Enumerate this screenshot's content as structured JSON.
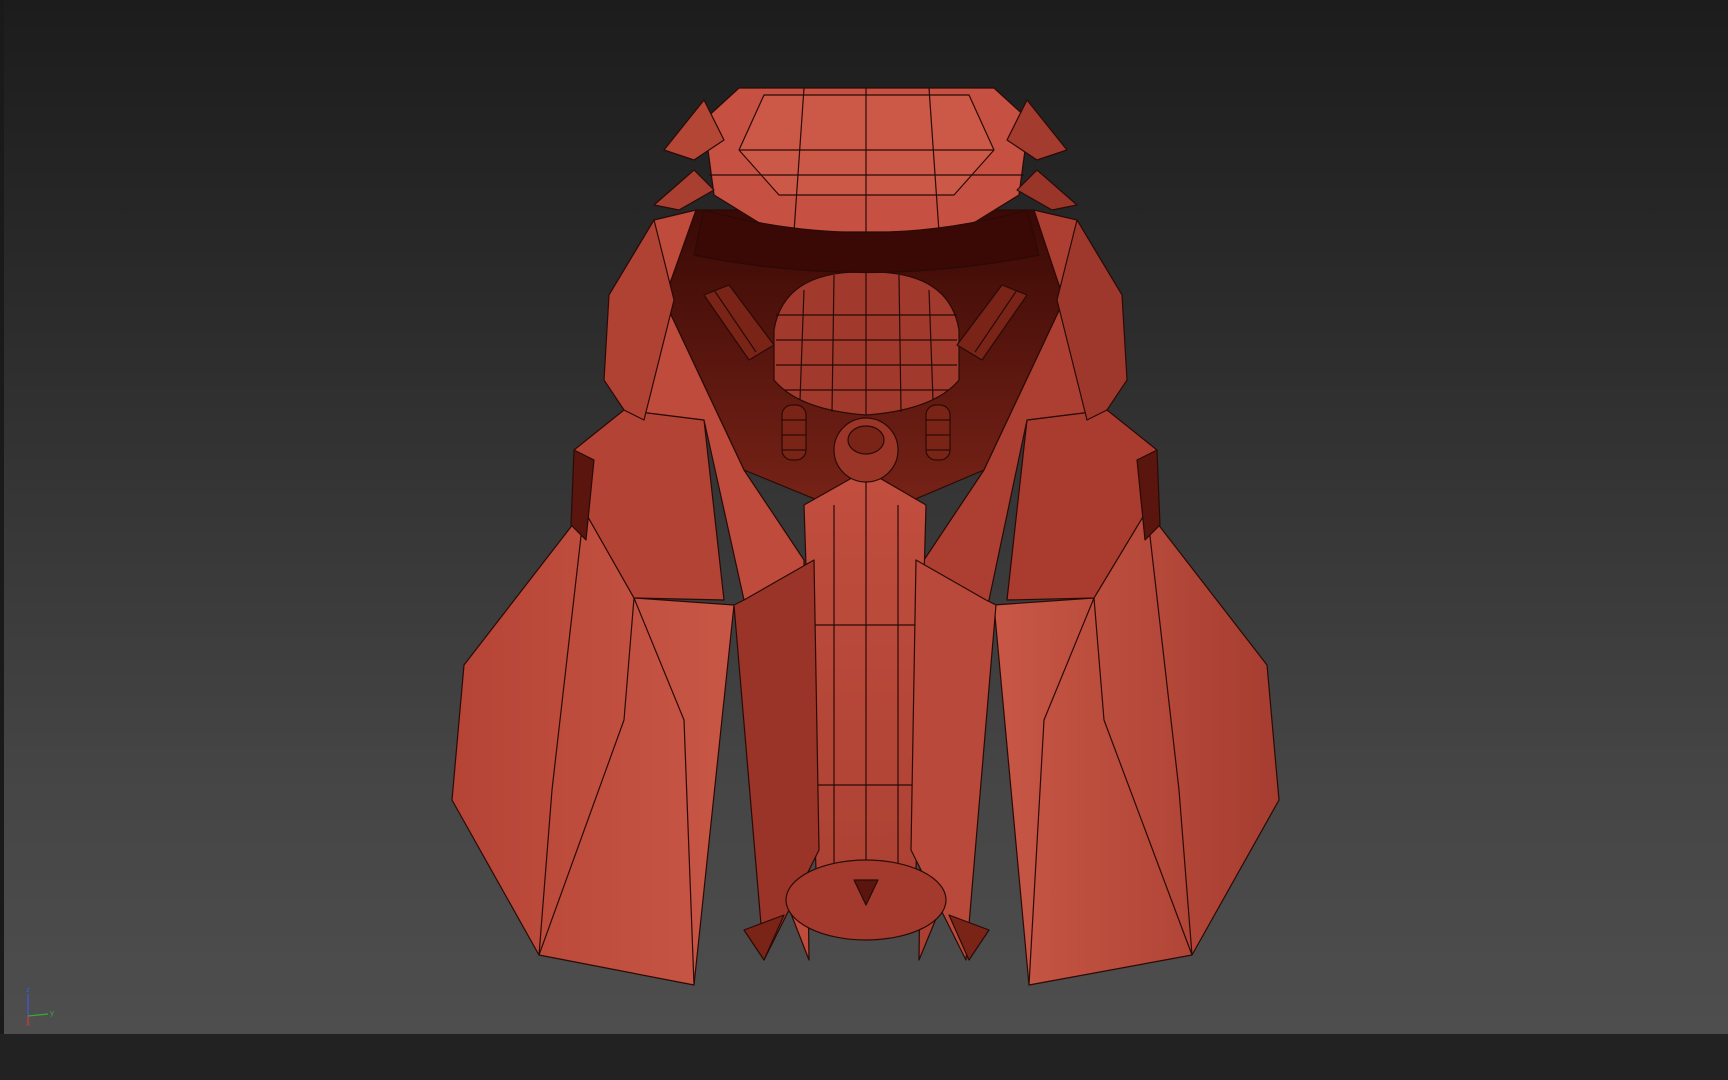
{
  "viewport": {
    "background_top": "#1c1c1c",
    "background_bottom": "#4e4e4e",
    "model_color": "#b8483a",
    "model_shadow": "#7a2418",
    "model_dark": "#4a0f0a",
    "wire_color": "#2a0a06"
  },
  "axis_gizmo": {
    "z_label": "z",
    "y_label": "y",
    "x_label": "x",
    "z_color": "#3a5bd8",
    "y_color": "#3aa83a",
    "x_color": "#d83a3a"
  }
}
